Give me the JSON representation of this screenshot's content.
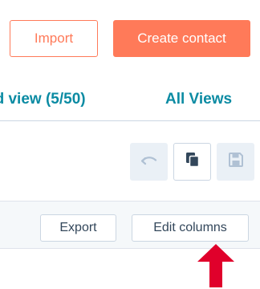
{
  "header": {
    "import_label": "Import",
    "create_contact_label": "Create contact"
  },
  "views": {
    "add_view_label": "dd view (5/50)",
    "all_views_label": "All Views"
  },
  "toolbar": {
    "undo_icon": "undo-icon",
    "clone_icon": "clone-icon",
    "save_icon": "save-icon"
  },
  "table_actions": {
    "export_label": "Export",
    "edit_columns_label": "Edit columns"
  },
  "colors": {
    "brand_orange": "#ff7a59",
    "link_teal": "#0b8ba3",
    "annotation_red": "#e0002b"
  }
}
